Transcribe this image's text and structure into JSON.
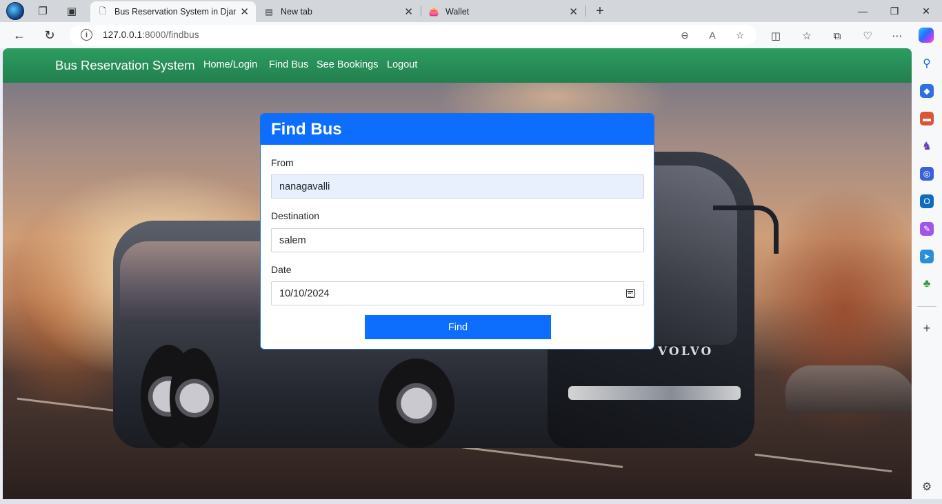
{
  "browser": {
    "tabs": [
      {
        "title": "Bus Reservation System in Django",
        "active": true
      },
      {
        "title": "New tab",
        "active": false
      },
      {
        "title": "Wallet",
        "active": false
      }
    ],
    "url_host": "127.0.0.1",
    "url_rest": ":8000/findbus"
  },
  "navbar": {
    "brand": "Bus Reservation System",
    "links": [
      "Home/Login",
      "Find Bus",
      "See Bookings",
      "Logout"
    ],
    "color": "#2a8f58"
  },
  "form": {
    "title": "Find Bus",
    "from_label": "From",
    "from_value": "nanagavalli",
    "destination_label": "Destination",
    "destination_value": "salem",
    "date_label": "Date",
    "date_value": "10/10/2024",
    "submit_label": "Find",
    "accent": "#0d6efd"
  },
  "background": {
    "brand_text": "VOLVO"
  }
}
